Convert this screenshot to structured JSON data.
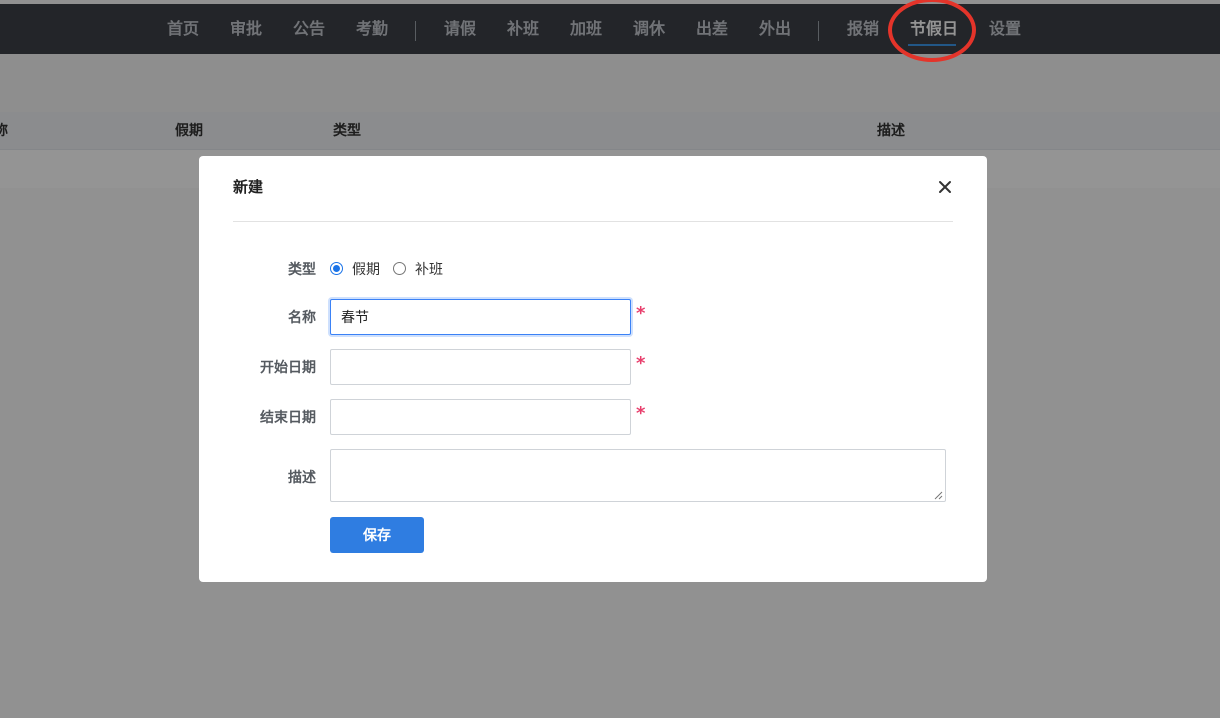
{
  "nav": {
    "items": [
      {
        "label": "首页"
      },
      {
        "label": "审批"
      },
      {
        "label": "公告"
      },
      {
        "label": "考勤"
      },
      {
        "label": "请假"
      },
      {
        "label": "补班"
      },
      {
        "label": "加班"
      },
      {
        "label": "调休"
      },
      {
        "label": "出差"
      },
      {
        "label": "外出"
      },
      {
        "label": "报销"
      },
      {
        "label": "节假日",
        "active": true
      },
      {
        "label": "设置"
      }
    ]
  },
  "table": {
    "columns": [
      "称",
      "假期",
      "类型",
      "描述"
    ]
  },
  "modal": {
    "title": "新建",
    "form": {
      "type_label": "类型",
      "type_options": [
        {
          "label": "假期",
          "checked": true
        },
        {
          "label": "补班",
          "checked": false
        }
      ],
      "name_label": "名称",
      "name_value": "春节",
      "start_label": "开始日期",
      "start_value": "",
      "end_label": "结束日期",
      "end_value": "",
      "desc_label": "描述",
      "desc_value": "",
      "required_mark": "*"
    },
    "save_label": "保存"
  },
  "colors": {
    "nav_bg": "#3d4147",
    "accent": "#2f7de1",
    "required": "#e83e6c",
    "highlight_ring": "#e4342a"
  }
}
